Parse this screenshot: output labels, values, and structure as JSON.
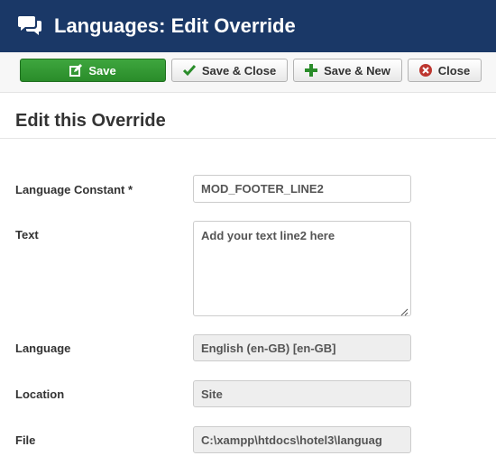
{
  "header": {
    "title": "Languages: Edit Override",
    "icon": "comments-icon",
    "bg_color": "#1a3867"
  },
  "toolbar": {
    "save_label": "Save",
    "save_close_label": "Save & Close",
    "save_new_label": "Save & New",
    "close_label": "Close",
    "save_color": "#2a8c2a",
    "close_icon_color": "#bd362f"
  },
  "form": {
    "title": "Edit this Override",
    "constant": {
      "label": "Language Constant *",
      "value": "MOD_FOOTER_LINE2"
    },
    "text": {
      "label": "Text",
      "value": "Add your text line2 here"
    },
    "language": {
      "label": "Language",
      "value": "English (en-GB) [en-GB]"
    },
    "location": {
      "label": "Location",
      "value": "Site"
    },
    "file": {
      "label": "File",
      "value": "C:\\xampp\\htdocs\\hotel3\\languag"
    }
  }
}
